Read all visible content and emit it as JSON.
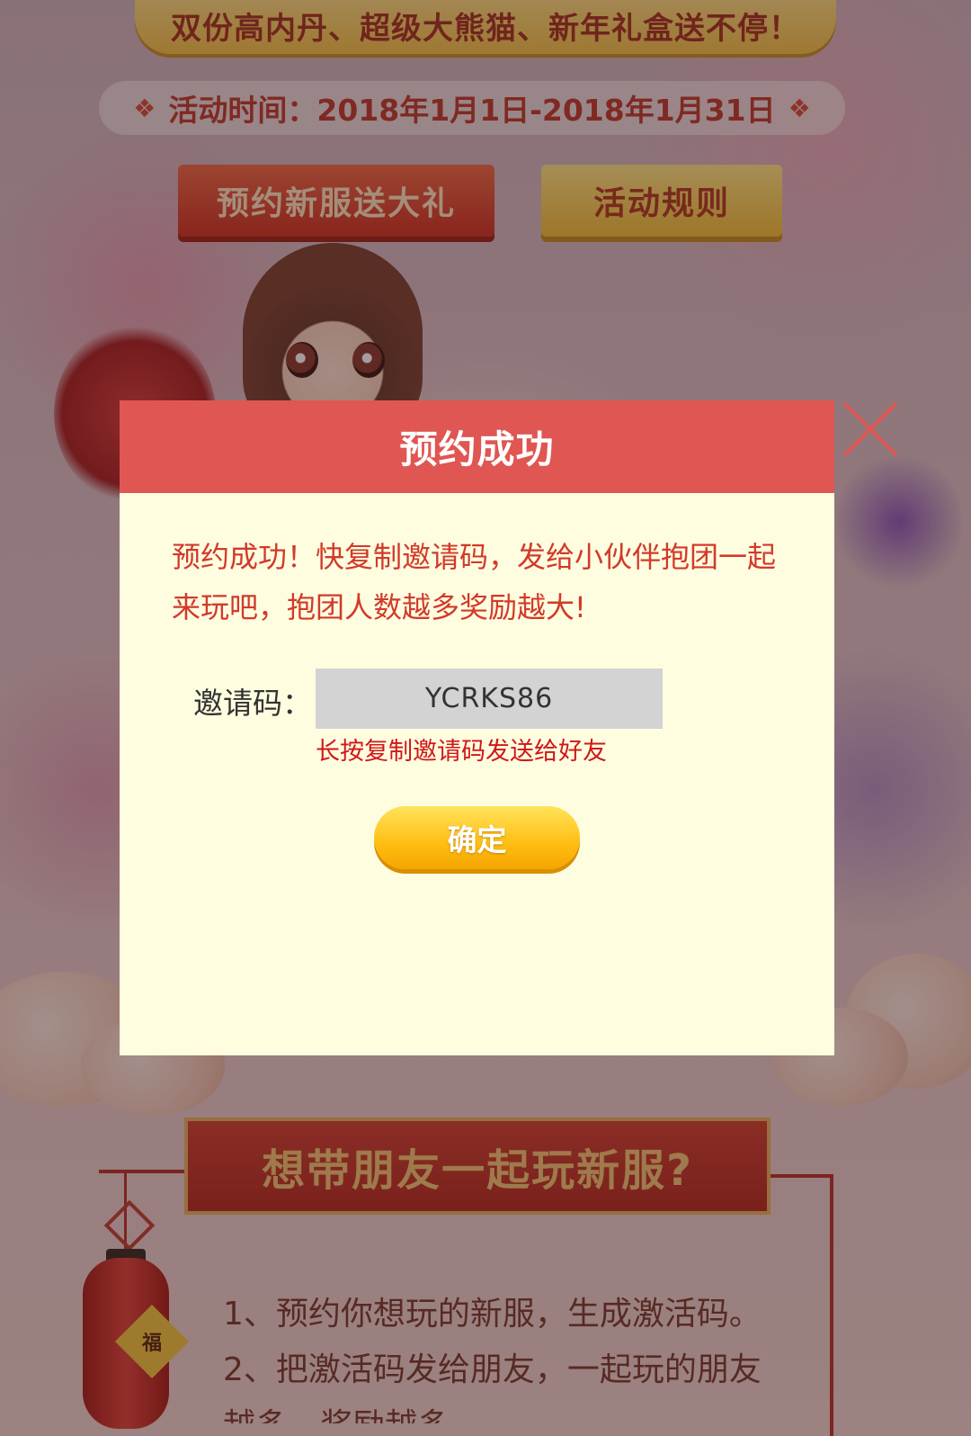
{
  "background": {
    "banner_text": "双份高内丹、超级大熊猫、新年礼盒送不停！",
    "event_time_label": "活动时间：2018年1月1日-2018年1月31日",
    "buttons": {
      "reserve": "预约新服送大礼",
      "rules": "活动规则"
    },
    "section_title": "想带朋友一起玩新服?",
    "lantern_char": "福",
    "steps": [
      "1、预约你想玩的新服，生成激活码。",
      "2、把激活码发给朋友，一起玩的朋友",
      "越多，奖励越多"
    ]
  },
  "modal": {
    "title": "预约成功",
    "message": "预约成功！快复制邀请码，发给小伙伴抱团一起来玩吧，抱团人数越多奖励越大!",
    "invite_label": "邀请码：",
    "invite_code": "YCRKS86",
    "invite_hint": "长按复制邀请码发送给好友",
    "confirm_label": "确定",
    "close_icon": "close-icon"
  },
  "colors": {
    "modal_header": "#e05652",
    "modal_body": "#fffde0",
    "message_text": "#d23a2a",
    "hint_text": "#d01818",
    "confirm_button": "#ffbe12",
    "close_icon": "#e05652"
  }
}
